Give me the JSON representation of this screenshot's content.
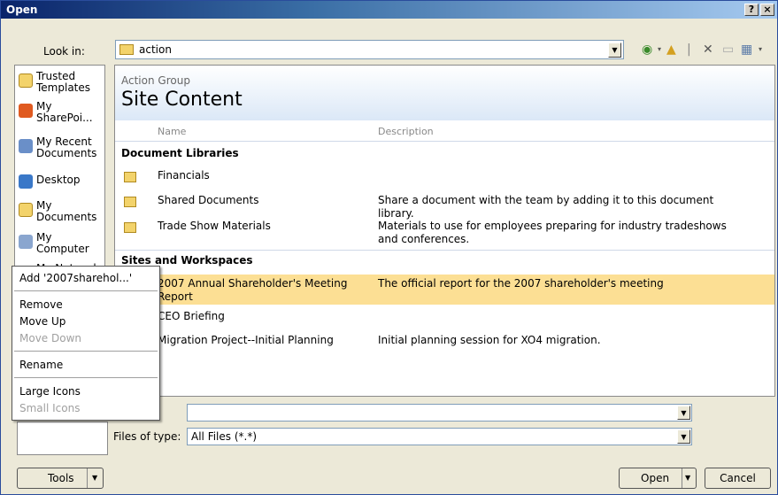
{
  "window": {
    "title": "Open",
    "help_label": "?",
    "close_label": "×"
  },
  "look_in": {
    "label": "Look in:",
    "value": "action"
  },
  "places": [
    {
      "label": "Trusted Templates"
    },
    {
      "label": "My SharePoi..."
    },
    {
      "label": "My Recent Documents"
    },
    {
      "label": "Desktop"
    },
    {
      "label": "My Documents"
    },
    {
      "label": "My Computer"
    },
    {
      "label": "My Network"
    }
  ],
  "site": {
    "group": "Action Group",
    "title": "Site Content"
  },
  "columns": {
    "name": "Name",
    "description": "Description"
  },
  "sections": {
    "libraries": "Document Libraries",
    "sites": "Sites and Workspaces"
  },
  "libraries": [
    {
      "name": "Financials",
      "description": ""
    },
    {
      "name": "Shared Documents",
      "description": "Share a document with the team by adding it to this document library."
    },
    {
      "name": "Trade Show Materials",
      "description": "Materials to use for employees preparing for industry tradeshows and conferences."
    }
  ],
  "sites": [
    {
      "name": "2007 Annual Shareholder's Meeting Report",
      "description": "The official report for the 2007 shareholder's meeting"
    },
    {
      "name": "CEO Briefing",
      "description": ""
    },
    {
      "name": "Migration Project--Initial Planning",
      "description": "Initial planning session for XO4 migration."
    }
  ],
  "context_menu": {
    "add": "Add '2007sharehol...'",
    "remove": "Remove",
    "move_up": "Move Up",
    "move_down": "Move Down",
    "rename": "Rename",
    "large_icons": "Large Icons",
    "small_icons": "Small Icons"
  },
  "file_name": {
    "value": ""
  },
  "file_type": {
    "label": "Files of type:",
    "value": "All Files (*.*)"
  },
  "buttons": {
    "tools": "Tools",
    "open": "Open",
    "cancel": "Cancel"
  },
  "colors": {
    "title_bar": "#0a246a",
    "selection": "#fcdf94",
    "dialog_bg": "#ece9d8"
  }
}
